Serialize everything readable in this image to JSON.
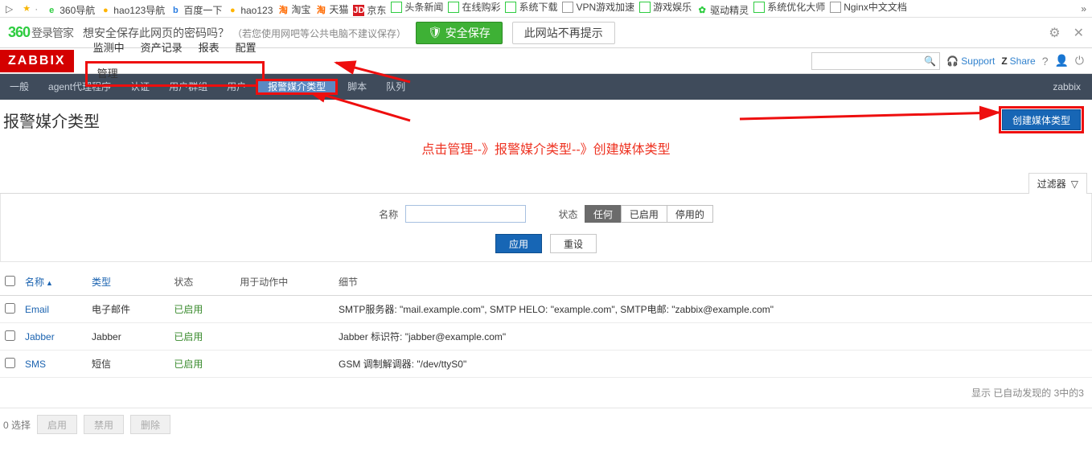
{
  "bookmarks": {
    "items": [
      {
        "icon": "i-360",
        "glyph": "e",
        "label": "360导航"
      },
      {
        "icon": "i-360y",
        "glyph": "●",
        "label": "hao123导航"
      },
      {
        "icon": "i-baidu",
        "glyph": "b",
        "label": "百度一下"
      },
      {
        "icon": "i-360y",
        "glyph": "●",
        "label": "hao123"
      },
      {
        "icon": "i-t",
        "glyph": "淘",
        "label": "淘宝"
      },
      {
        "icon": "i-t",
        "glyph": "淘",
        "label": "天猫"
      },
      {
        "icon": "i-jd",
        "glyph": "JD",
        "label": "京东"
      },
      {
        "icon": "i-box",
        "glyph": "",
        "label": "头条新闻"
      },
      {
        "icon": "i-box",
        "glyph": "",
        "label": "在线购彩"
      },
      {
        "icon": "i-box",
        "glyph": "",
        "label": "系统下载"
      },
      {
        "icon": "i-boxg",
        "glyph": "",
        "label": "VPN游戏加速"
      },
      {
        "icon": "i-box",
        "glyph": "",
        "label": "游戏娱乐"
      },
      {
        "icon": "i-360",
        "glyph": "✿",
        "label": "驱动精灵"
      },
      {
        "icon": "i-box",
        "glyph": "",
        "label": "系统优化大师"
      },
      {
        "icon": "i-boxg",
        "glyph": "",
        "label": "Nginx中文文档"
      }
    ]
  },
  "pwdbar": {
    "brand_num": "360",
    "brand_txt": "登录管家",
    "question": "想安全保存此网页的密码吗？",
    "hint": "（若您使用网吧等公共电脑不建议保存）",
    "save_btn": "安全保存",
    "dismiss_btn": "此网站不再提示"
  },
  "topnav": {
    "logo": "ZABBIX",
    "items": [
      "监测中",
      "资产记录",
      "报表",
      "配置",
      "管理"
    ],
    "active_index": 4,
    "support": "Support",
    "share": "Share"
  },
  "subnav": {
    "items": [
      "一般",
      "agent代理程序",
      "认证",
      "用户群组",
      "用户",
      "报警媒介类型",
      "脚本",
      "队列"
    ],
    "active_index": 5,
    "user": "zabbix"
  },
  "page": {
    "title": "报警媒介类型",
    "create_btn": "创建媒体类型",
    "annotation": "点击管理--》报警媒介类型--》创建媒体类型"
  },
  "filter": {
    "tab": "过滤器",
    "name_label": "名称",
    "name_value": "",
    "state_label": "状态",
    "seg": [
      "任何",
      "已启用",
      "停用的"
    ],
    "seg_active": 0,
    "apply": "应用",
    "reset": "重设"
  },
  "table": {
    "headers": {
      "name": "名称",
      "type": "类型",
      "status": "状态",
      "actions": "用于动作中",
      "details": "细节"
    },
    "rows": [
      {
        "name": "Email",
        "type": "电子邮件",
        "status": "已启用",
        "details": "SMTP服务器: \"mail.example.com\", SMTP HELO: \"example.com\", SMTP电邮: \"zabbix@example.com\""
      },
      {
        "name": "Jabber",
        "type": "Jabber",
        "status": "已启用",
        "details": "Jabber 标识符: \"jabber@example.com\""
      },
      {
        "name": "SMS",
        "type": "短信",
        "status": "已启用",
        "details": "GSM 调制解调器: \"/dev/ttyS0\""
      }
    ],
    "footer": "显示 已自动发现的 3中的3"
  },
  "batch": {
    "selected": "0 选择",
    "enable": "启用",
    "disable": "禁用",
    "delete": "删除"
  }
}
